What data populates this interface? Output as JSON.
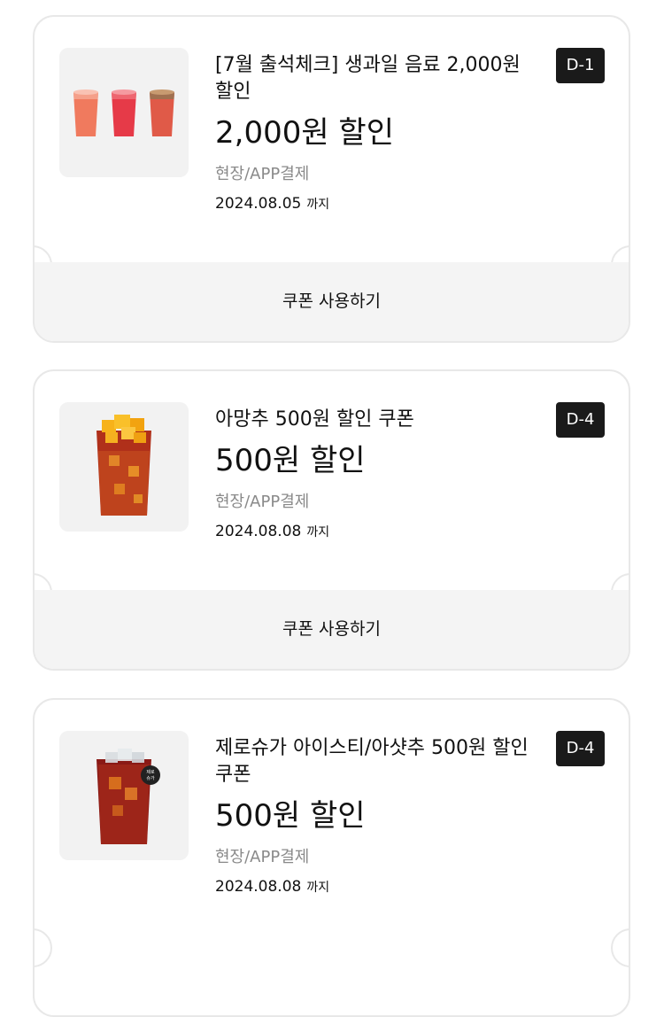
{
  "coupons": [
    {
      "title": "[7월 출석체크] 생과일 음료 2,000원 할인",
      "amount": "2,000원 할인",
      "method": "현장/APP결제",
      "expire_date": "2024.08.05",
      "expire_suffix": "까지",
      "dday": "D-1",
      "use_label": "쿠폰 사용하기",
      "image_icon": "fruit-juice-cups-icon"
    },
    {
      "title": "아망추 500원 할인 쿠폰",
      "amount": "500원 할인",
      "method": "현장/APP결제",
      "expire_date": "2024.08.08",
      "expire_suffix": "까지",
      "dday": "D-4",
      "use_label": "쿠폰 사용하기",
      "image_icon": "mango-iced-tea-icon"
    },
    {
      "title": "제로슈가 아이스티/아샷추 500원 할인 쿠폰",
      "amount": "500원 할인",
      "method": "현장/APP결제",
      "expire_date": "2024.08.08",
      "expire_suffix": "까지",
      "dday": "D-4",
      "badge": "제로 슈가",
      "image_icon": "zero-sugar-iced-tea-icon"
    }
  ],
  "colors": {
    "dday_bg": "#1a1a1a",
    "card_border": "#e8e8e8",
    "use_bar_bg": "#f4f4f4",
    "thumb_bg": "#f2f2f2",
    "muted_text": "#8a8a8a"
  }
}
